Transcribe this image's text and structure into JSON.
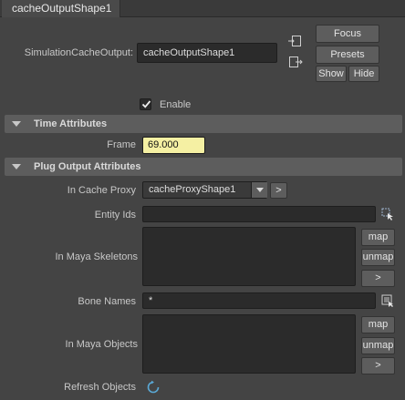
{
  "tab": {
    "title": "cacheOutputShape1"
  },
  "header": {
    "node_label": "SimulationCacheOutput:",
    "node_value": "cacheOutputShape1",
    "focus_label": "Focus",
    "presets_label": "Presets",
    "show_label": "Show",
    "hide_label": "Hide",
    "input_icon": "connection-in-icon",
    "output_icon": "connection-out-icon"
  },
  "enable": {
    "label": "Enable",
    "checked": true
  },
  "time_attributes": {
    "title": "Time Attributes",
    "frame_label": "Frame",
    "frame_value": "69.000"
  },
  "plug_output": {
    "title": "Plug Output Attributes",
    "in_cache_proxy": {
      "label": "In Cache Proxy",
      "value": "cacheProxyShape1",
      "go_label": ">"
    },
    "entity_ids": {
      "label": "Entity Ids",
      "value": ""
    },
    "in_maya_skeletons": {
      "label": "In Maya Skeletons",
      "map_label": "map",
      "unmap_label": "unmap",
      "go_label": ">"
    },
    "bone_names": {
      "label": "Bone Names",
      "value": "*"
    },
    "in_maya_objects": {
      "label": "In Maya Objects",
      "map_label": "map",
      "unmap_label": "unmap",
      "go_label": ">"
    },
    "refresh_objects": {
      "label": "Refresh Objects"
    }
  },
  "colors": {
    "background": "#444444",
    "section": "#5d5d5d",
    "field": "#2b2b2b",
    "frame_highlight": "#f5f0a3",
    "refresh_icon": "#5aa9d6"
  }
}
